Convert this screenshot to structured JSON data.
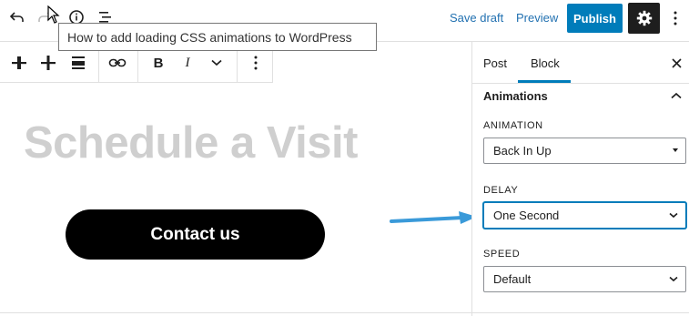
{
  "topbar": {
    "save_draft": "Save draft",
    "preview": "Preview",
    "publish": "Publish",
    "tooltip": "How to add loading CSS animations to WordPress"
  },
  "canvas": {
    "heading": "Schedule a Visit",
    "button_label": "Contact us"
  },
  "sidebar": {
    "tabs": [
      "Post",
      "Block"
    ],
    "active_tab": "Block",
    "panel_title": "Animations",
    "fields": [
      {
        "label": "ANIMATION",
        "value": "Back In Up"
      },
      {
        "label": "DELAY",
        "value": "One Second"
      },
      {
        "label": "SPEED",
        "value": "Default"
      }
    ]
  },
  "colors": {
    "accent": "#007cba",
    "link": "#2271b1",
    "arrow": "#3a9ad9"
  }
}
